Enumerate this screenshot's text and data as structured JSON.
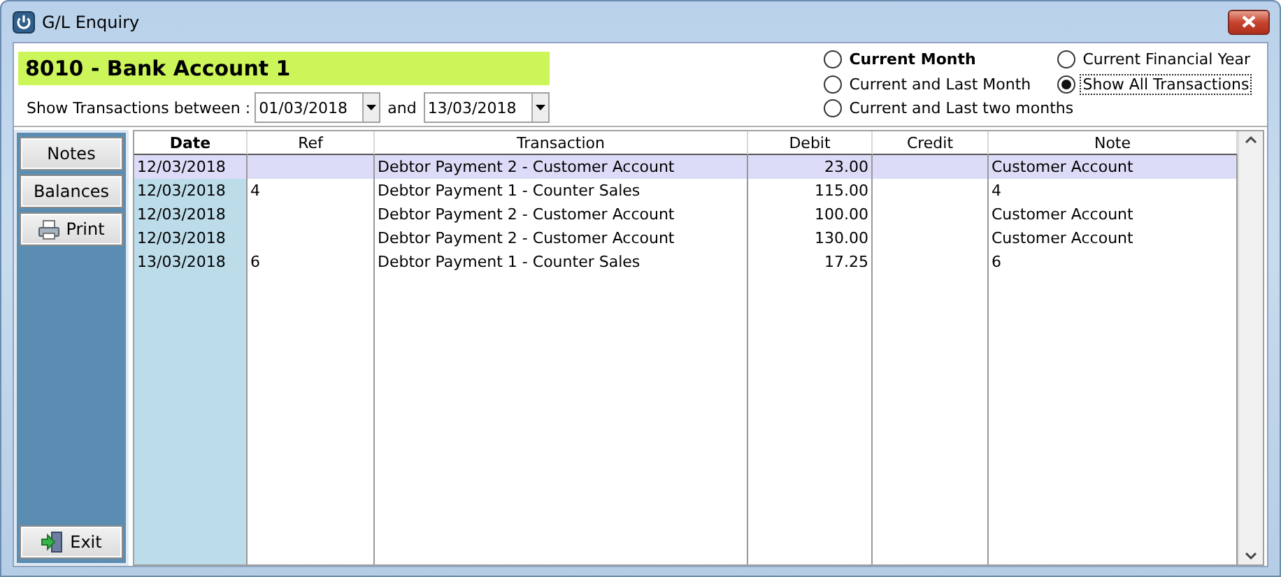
{
  "window": {
    "title": "G/L Enquiry"
  },
  "account": "8010 - Bank Account 1",
  "date_range": {
    "label": "Show Transactions between :",
    "from": "01/03/2018",
    "joiner": "and",
    "to": "13/03/2018"
  },
  "period_options": [
    {
      "label": "Current Month",
      "selected": false,
      "bold": true
    },
    {
      "label": "Current Financial Year",
      "selected": false,
      "bold": false
    },
    {
      "label": "Current and Last Month",
      "selected": false,
      "bold": false
    },
    {
      "label": "Show All Transactions",
      "selected": true,
      "bold": false
    },
    {
      "label": "Current and Last two months",
      "selected": false,
      "bold": false
    }
  ],
  "sidebar": {
    "buttons": [
      {
        "label": "Notes",
        "kind": "text"
      },
      {
        "label": "Balances",
        "kind": "text"
      },
      {
        "label": "Print",
        "kind": "print"
      }
    ],
    "exit_button": {
      "label": "Exit"
    }
  },
  "table": {
    "columns": [
      {
        "label": "Date",
        "kind": "date"
      },
      {
        "label": "Ref",
        "kind": "text"
      },
      {
        "label": "Transaction",
        "kind": "text"
      },
      {
        "label": "Debit",
        "kind": "amount"
      },
      {
        "label": "Credit",
        "kind": "amount"
      },
      {
        "label": "Note",
        "kind": "text"
      }
    ],
    "rows": [
      {
        "selected": true,
        "cells": [
          "12/03/2018",
          "",
          "Debtor Payment 2 - Customer Account",
          "23.00",
          "",
          "Customer Account"
        ]
      },
      {
        "selected": false,
        "cells": [
          "12/03/2018",
          "4",
          "Debtor Payment 1 - Counter Sales",
          "115.00",
          "",
          "4"
        ]
      },
      {
        "selected": false,
        "cells": [
          "12/03/2018",
          "",
          "Debtor Payment 2 - Customer Account",
          "100.00",
          "",
          "Customer Account"
        ]
      },
      {
        "selected": false,
        "cells": [
          "12/03/2018",
          "",
          "Debtor Payment 2 - Customer Account",
          "130.00",
          "",
          "Customer Account"
        ]
      },
      {
        "selected": false,
        "cells": [
          "13/03/2018",
          "6",
          "Debtor Payment 1 - Counter Sales",
          "17.25",
          "",
          "6"
        ]
      }
    ]
  }
}
